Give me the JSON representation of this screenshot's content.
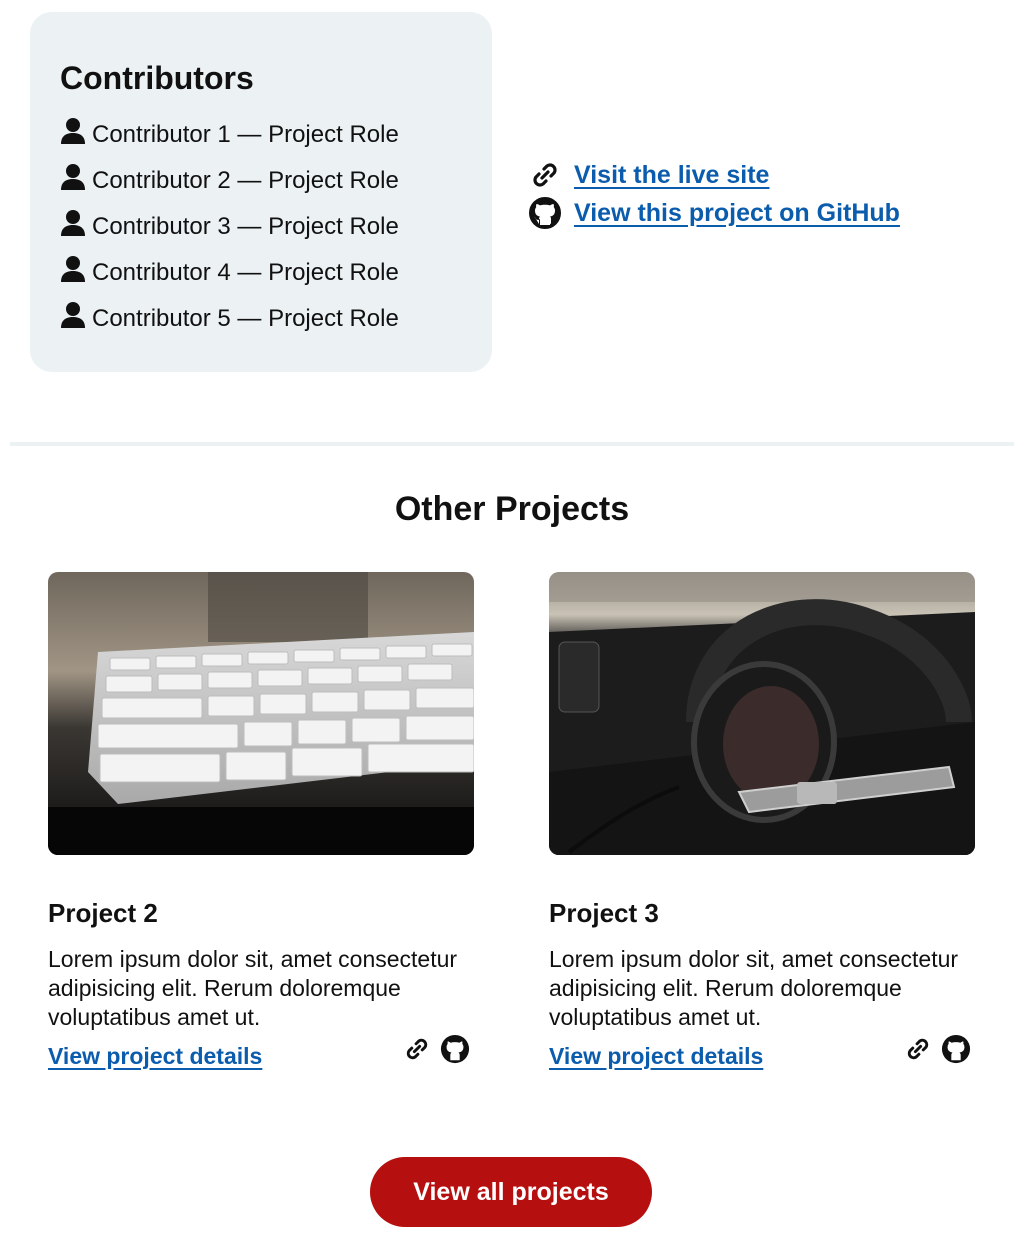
{
  "contributors": {
    "title": "Contributors",
    "items": [
      {
        "label": "Contributor 1 — Project Role"
      },
      {
        "label": "Contributor 2 — Project Role"
      },
      {
        "label": "Contributor 3 — Project Role"
      },
      {
        "label": "Contributor 4 — Project Role"
      },
      {
        "label": "Contributor 5 — Project Role"
      }
    ]
  },
  "links": {
    "live_site": "Visit the live site",
    "github": "View this project on GitHub"
  },
  "other_projects": {
    "title": "Other Projects",
    "cards": [
      {
        "title": "Project 2",
        "description": "Lorem ipsum dolor sit, amet consectetur adipisicing elit. Rerum doloremque voluptatibus amet ut.",
        "link": "View project details",
        "image_icon": "keyboard-photo"
      },
      {
        "title": "Project 3",
        "description": "Lorem ipsum dolor sit, amet consectetur adipisicing elit. Rerum doloremque voluptatibus amet ut.",
        "link": "View project details",
        "image_icon": "headphones-photo"
      }
    ]
  },
  "view_all_label": "View all projects",
  "colors": {
    "link": "#0b5cad",
    "card_bg": "#ecf1f3",
    "button": "#b50f0f"
  },
  "icons": {
    "person": "person-icon",
    "link": "link-icon",
    "github": "github-icon"
  }
}
